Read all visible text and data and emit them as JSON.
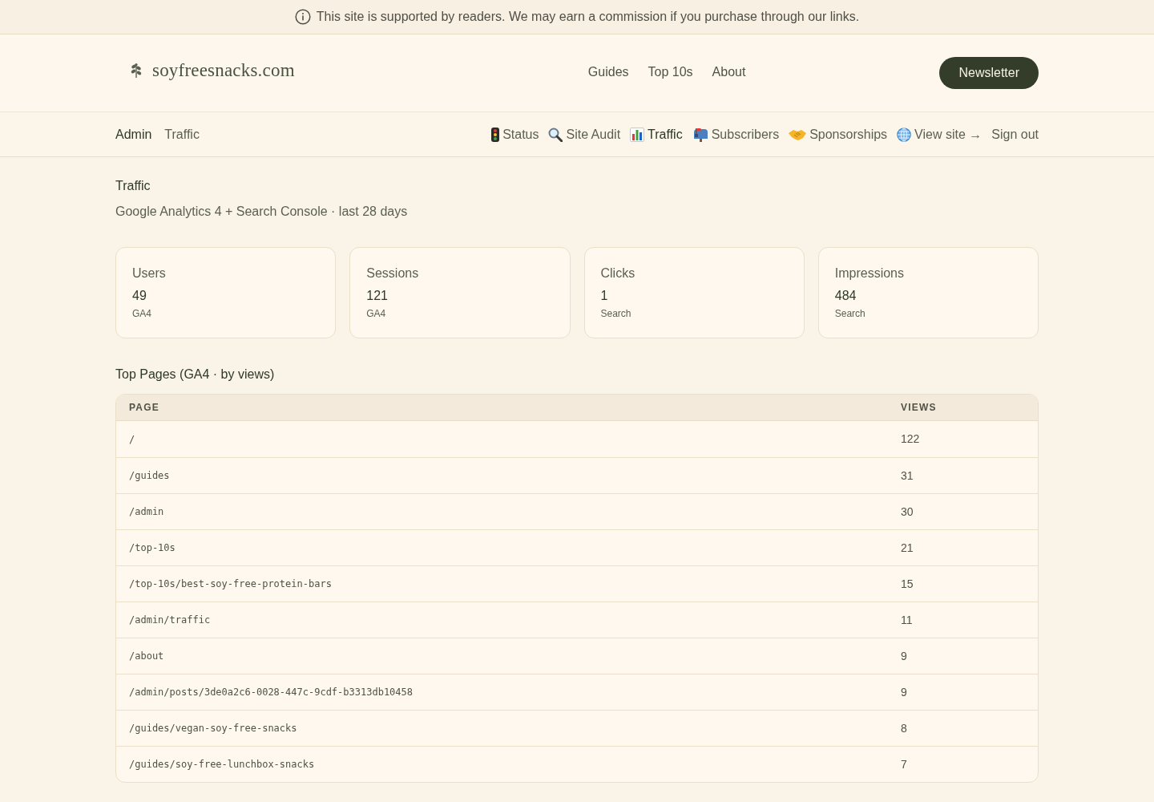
{
  "notice_bar": {
    "text": "This site is supported by readers. We may earn a commission if you purchase through our links."
  },
  "header": {
    "logo": "soyfreesnacks.com",
    "nav": [
      {
        "label": "Guides"
      },
      {
        "label": "Top 10s"
      },
      {
        "label": "About"
      }
    ],
    "newsletter_button": "Newsletter"
  },
  "admin_bar": {
    "breadcrumb": [
      "Admin",
      "Traffic"
    ],
    "nav": [
      {
        "label": "Status",
        "selected": false
      },
      {
        "label": "Site Audit",
        "selected": false
      },
      {
        "label": "Traffic",
        "selected": true
      },
      {
        "label": "Subscribers",
        "selected": false
      },
      {
        "label": "Sponsorships",
        "selected": false
      },
      {
        "label": "View site →",
        "selected": false
      },
      {
        "label": "Sign out",
        "selected": false
      }
    ]
  },
  "page": {
    "title": "Traffic",
    "subtitle": "Google Analytics 4 + Search Console · last 28 days"
  },
  "stats": [
    {
      "label": "Users",
      "value": "49",
      "source": "GA4"
    },
    {
      "label": "Sessions",
      "value": "121",
      "source": "GA4"
    },
    {
      "label": "Clicks",
      "value": "1",
      "source": "Search"
    },
    {
      "label": "Impressions",
      "value": "484",
      "source": "Search"
    }
  ],
  "top_pages": {
    "title": "Top Pages (GA4 · by views)",
    "columns": [
      "PAGE",
      "VIEWS"
    ],
    "rows": [
      {
        "page": "/",
        "views": "122"
      },
      {
        "page": "/guides",
        "views": "31"
      },
      {
        "page": "/admin",
        "views": "30"
      },
      {
        "page": "/top-10s",
        "views": "21"
      },
      {
        "page": "/top-10s/best-soy-free-protein-bars",
        "views": "15"
      },
      {
        "page": "/admin/traffic",
        "views": "11"
      },
      {
        "page": "/about",
        "views": "9"
      },
      {
        "page": "/admin/posts/3de0a2c6-0028-447c-9cdf-b3313db10458",
        "views": "9"
      },
      {
        "page": "/guides/vegan-soy-free-snacks",
        "views": "8"
      },
      {
        "page": "/guides/soy-free-lunchbox-snacks",
        "views": "7"
      }
    ]
  }
}
